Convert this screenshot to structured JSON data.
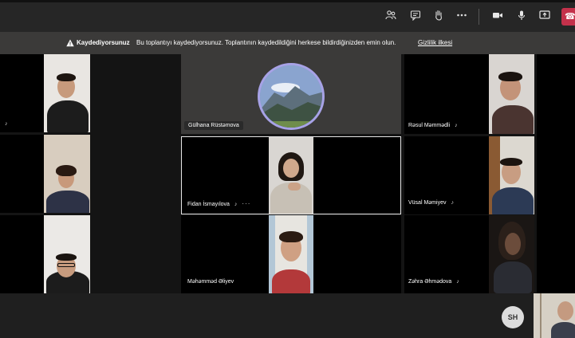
{
  "toolbar": {
    "icons": [
      "participants-icon",
      "chat-icon",
      "raise-hand-icon",
      "more-actions-icon",
      "camera-icon",
      "mic-icon",
      "share-screen-icon",
      "leave-call-icon"
    ]
  },
  "banner": {
    "title": "Kaydediyorsunuz",
    "text": "Bu toplantıyı kaydediyorsunuz. Toplantının kaydedildiğini herkese bildirdiğinizden emin olun.",
    "link": "Gizlilik ilkesi"
  },
  "participants": {
    "gulhana": "Gülhana Rüstəmova",
    "rasul": "Rəsul Məmmədli",
    "fidan": "Fidan İsmayılova",
    "vusal": "Vüsal Məmiyev",
    "mahammad": "Məhəmməd Əliyev",
    "zahra": "Zəhra Əhmədova",
    "more_label": "···"
  },
  "self": {
    "initials": "SH"
  },
  "colors": {
    "banner_bg": "#3b3a39",
    "toolbar_bg": "#262626",
    "leave_red": "#c4314b",
    "avatar_ring": "#a7a2e6"
  }
}
